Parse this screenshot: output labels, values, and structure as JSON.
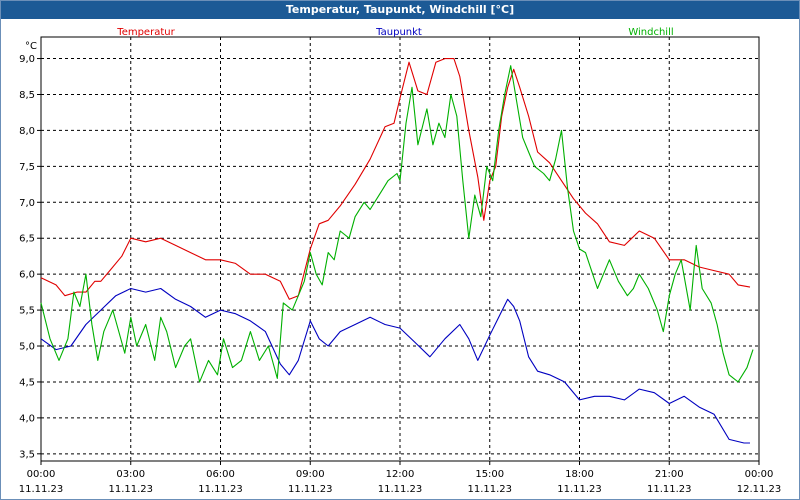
{
  "window": {
    "title": "Temperatur, Taupunkt, Windchill [°C]"
  },
  "colors": {
    "temperatur": "#e00000",
    "taupunkt": "#0000c0",
    "windchill": "#00b000",
    "grid": "#000000",
    "title_bar": "#1c5a96"
  },
  "chart_data": {
    "type": "line",
    "title": "Temperatur, Taupunkt, Windchill [°C]",
    "ylabel": "°C",
    "ylim": [
      3.4,
      9.3
    ],
    "xlim": [
      "11.11.23 00:00",
      "12.11.23 00:00"
    ],
    "y_ticks": [
      "3,5",
      "4,0",
      "4,5",
      "5,0",
      "5,5",
      "6,0",
      "6,5",
      "7,0",
      "7,5",
      "8,0",
      "8,5",
      "9,0"
    ],
    "x_ticks": [
      {
        "time": "00:00",
        "date": "11.11.23"
      },
      {
        "time": "03:00",
        "date": "11.11.23"
      },
      {
        "time": "06:00",
        "date": "11.11.23"
      },
      {
        "time": "09:00",
        "date": "11.11.23"
      },
      {
        "time": "12:00",
        "date": "11.11.23"
      },
      {
        "time": "15:00",
        "date": "11.11.23"
      },
      {
        "time": "18:00",
        "date": "11.11.23"
      },
      {
        "time": "21:00",
        "date": "11.11.23"
      },
      {
        "time": "00:00",
        "date": "12.11.23"
      }
    ],
    "grid": true,
    "legend_position": "top",
    "series": [
      {
        "name": "Temperatur",
        "points": [
          [
            0,
            5.95
          ],
          [
            0.5,
            5.85
          ],
          [
            0.8,
            5.7
          ],
          [
            1.2,
            5.75
          ],
          [
            1.5,
            5.75
          ],
          [
            1.8,
            5.9
          ],
          [
            2,
            5.9
          ],
          [
            2.3,
            6.05
          ],
          [
            2.7,
            6.25
          ],
          [
            3,
            6.5
          ],
          [
            3.5,
            6.45
          ],
          [
            4,
            6.5
          ],
          [
            4.5,
            6.4
          ],
          [
            5,
            6.3
          ],
          [
            5.5,
            6.2
          ],
          [
            6,
            6.2
          ],
          [
            6.5,
            6.15
          ],
          [
            7,
            6.0
          ],
          [
            7.5,
            6.0
          ],
          [
            8,
            5.9
          ],
          [
            8.3,
            5.65
          ],
          [
            8.6,
            5.7
          ],
          [
            9,
            6.35
          ],
          [
            9.3,
            6.7
          ],
          [
            9.6,
            6.75
          ],
          [
            10,
            6.95
          ],
          [
            10.5,
            7.25
          ],
          [
            11,
            7.6
          ],
          [
            11.5,
            8.05
          ],
          [
            11.8,
            8.1
          ],
          [
            12,
            8.45
          ],
          [
            12.3,
            8.95
          ],
          [
            12.6,
            8.55
          ],
          [
            12.9,
            8.5
          ],
          [
            13.2,
            8.95
          ],
          [
            13.5,
            9.0
          ],
          [
            13.8,
            9.0
          ],
          [
            14,
            8.75
          ],
          [
            14.3,
            8.0
          ],
          [
            14.6,
            7.35
          ],
          [
            14.8,
            6.75
          ],
          [
            15,
            7.3
          ],
          [
            15.2,
            7.5
          ],
          [
            15.4,
            8.2
          ],
          [
            15.6,
            8.6
          ],
          [
            15.8,
            8.85
          ],
          [
            16,
            8.6
          ],
          [
            16.3,
            8.2
          ],
          [
            16.6,
            7.7
          ],
          [
            17,
            7.55
          ],
          [
            17.4,
            7.3
          ],
          [
            17.8,
            7.05
          ],
          [
            18.2,
            6.85
          ],
          [
            18.6,
            6.7
          ],
          [
            19,
            6.45
          ],
          [
            19.5,
            6.4
          ],
          [
            20,
            6.6
          ],
          [
            20.5,
            6.5
          ],
          [
            21,
            6.2
          ],
          [
            21.5,
            6.2
          ],
          [
            22,
            6.1
          ],
          [
            22.5,
            6.05
          ],
          [
            23,
            6.0
          ],
          [
            23.3,
            5.85
          ],
          [
            23.7,
            5.82
          ]
        ]
      },
      {
        "name": "Taupunkt",
        "points": [
          [
            0,
            5.1
          ],
          [
            0.5,
            4.95
          ],
          [
            1,
            5.0
          ],
          [
            1.5,
            5.3
          ],
          [
            2,
            5.5
          ],
          [
            2.5,
            5.7
          ],
          [
            3,
            5.8
          ],
          [
            3.5,
            5.75
          ],
          [
            4,
            5.8
          ],
          [
            4.5,
            5.65
          ],
          [
            5,
            5.55
          ],
          [
            5.5,
            5.4
          ],
          [
            6,
            5.5
          ],
          [
            6.5,
            5.45
          ],
          [
            7,
            5.35
          ],
          [
            7.5,
            5.2
          ],
          [
            8,
            4.75
          ],
          [
            8.3,
            4.6
          ],
          [
            8.6,
            4.8
          ],
          [
            9,
            5.35
          ],
          [
            9.3,
            5.1
          ],
          [
            9.6,
            5.0
          ],
          [
            10,
            5.2
          ],
          [
            10.5,
            5.3
          ],
          [
            11,
            5.4
          ],
          [
            11.5,
            5.3
          ],
          [
            12,
            5.25
          ],
          [
            12.5,
            5.05
          ],
          [
            13,
            4.85
          ],
          [
            13.5,
            5.1
          ],
          [
            14,
            5.3
          ],
          [
            14.3,
            5.1
          ],
          [
            14.6,
            4.8
          ],
          [
            15,
            5.15
          ],
          [
            15.3,
            5.4
          ],
          [
            15.6,
            5.65
          ],
          [
            15.8,
            5.55
          ],
          [
            16,
            5.35
          ],
          [
            16.3,
            4.85
          ],
          [
            16.6,
            4.65
          ],
          [
            17,
            4.6
          ],
          [
            17.5,
            4.5
          ],
          [
            18,
            4.25
          ],
          [
            18.5,
            4.3
          ],
          [
            19,
            4.3
          ],
          [
            19.5,
            4.25
          ],
          [
            20,
            4.4
          ],
          [
            20.5,
            4.35
          ],
          [
            21,
            4.2
          ],
          [
            21.5,
            4.3
          ],
          [
            22,
            4.15
          ],
          [
            22.5,
            4.05
          ],
          [
            23,
            3.7
          ],
          [
            23.5,
            3.65
          ],
          [
            23.7,
            3.65
          ]
        ]
      },
      {
        "name": "Windchill",
        "points": [
          [
            0,
            5.6
          ],
          [
            0.3,
            5.1
          ],
          [
            0.6,
            4.8
          ],
          [
            0.9,
            5.1
          ],
          [
            1.1,
            5.75
          ],
          [
            1.3,
            5.55
          ],
          [
            1.5,
            6.0
          ],
          [
            1.7,
            5.3
          ],
          [
            1.9,
            4.8
          ],
          [
            2.1,
            5.2
          ],
          [
            2.4,
            5.5
          ],
          [
            2.6,
            5.2
          ],
          [
            2.8,
            4.9
          ],
          [
            3,
            5.4
          ],
          [
            3.2,
            5.0
          ],
          [
            3.5,
            5.3
          ],
          [
            3.8,
            4.8
          ],
          [
            4,
            5.4
          ],
          [
            4.2,
            5.2
          ],
          [
            4.5,
            4.7
          ],
          [
            4.8,
            5.0
          ],
          [
            5,
            5.1
          ],
          [
            5.3,
            4.5
          ],
          [
            5.6,
            4.8
          ],
          [
            5.9,
            4.6
          ],
          [
            6.1,
            5.1
          ],
          [
            6.4,
            4.7
          ],
          [
            6.7,
            4.8
          ],
          [
            7,
            5.2
          ],
          [
            7.3,
            4.8
          ],
          [
            7.6,
            5.0
          ],
          [
            7.9,
            4.55
          ],
          [
            8.1,
            5.6
          ],
          [
            8.4,
            5.5
          ],
          [
            8.6,
            5.7
          ],
          [
            8.8,
            5.9
          ],
          [
            9,
            6.3
          ],
          [
            9.2,
            6.0
          ],
          [
            9.4,
            5.85
          ],
          [
            9.6,
            6.3
          ],
          [
            9.8,
            6.2
          ],
          [
            10,
            6.6
          ],
          [
            10.3,
            6.5
          ],
          [
            10.5,
            6.8
          ],
          [
            10.8,
            7.0
          ],
          [
            11,
            6.9
          ],
          [
            11.3,
            7.1
          ],
          [
            11.6,
            7.3
          ],
          [
            11.9,
            7.4
          ],
          [
            12,
            7.3
          ],
          [
            12.2,
            8.1
          ],
          [
            12.4,
            8.6
          ],
          [
            12.6,
            7.8
          ],
          [
            12.9,
            8.3
          ],
          [
            13.1,
            7.8
          ],
          [
            13.3,
            8.1
          ],
          [
            13.5,
            7.9
          ],
          [
            13.7,
            8.5
          ],
          [
            13.9,
            8.2
          ],
          [
            14.1,
            7.3
          ],
          [
            14.3,
            6.5
          ],
          [
            14.5,
            7.1
          ],
          [
            14.7,
            6.8
          ],
          [
            14.9,
            7.5
          ],
          [
            15.1,
            7.3
          ],
          [
            15.3,
            8.0
          ],
          [
            15.5,
            8.5
          ],
          [
            15.7,
            8.9
          ],
          [
            15.9,
            8.4
          ],
          [
            16.1,
            7.9
          ],
          [
            16.3,
            7.7
          ],
          [
            16.5,
            7.5
          ],
          [
            16.8,
            7.4
          ],
          [
            17,
            7.3
          ],
          [
            17.2,
            7.6
          ],
          [
            17.4,
            8.0
          ],
          [
            17.6,
            7.2
          ],
          [
            17.8,
            6.6
          ],
          [
            18,
            6.35
          ],
          [
            18.2,
            6.3
          ],
          [
            18.4,
            6.05
          ],
          [
            18.6,
            5.8
          ],
          [
            18.8,
            6.0
          ],
          [
            19,
            6.2
          ],
          [
            19.3,
            5.9
          ],
          [
            19.6,
            5.7
          ],
          [
            19.8,
            5.8
          ],
          [
            20,
            6.0
          ],
          [
            20.3,
            5.8
          ],
          [
            20.6,
            5.5
          ],
          [
            20.8,
            5.2
          ],
          [
            21,
            5.7
          ],
          [
            21.2,
            6.0
          ],
          [
            21.4,
            6.2
          ],
          [
            21.7,
            5.5
          ],
          [
            21.9,
            6.4
          ],
          [
            22.1,
            5.8
          ],
          [
            22.4,
            5.6
          ],
          [
            22.6,
            5.3
          ],
          [
            22.8,
            4.9
          ],
          [
            23,
            4.6
          ],
          [
            23.3,
            4.5
          ],
          [
            23.6,
            4.7
          ],
          [
            23.8,
            4.95
          ]
        ]
      }
    ]
  }
}
